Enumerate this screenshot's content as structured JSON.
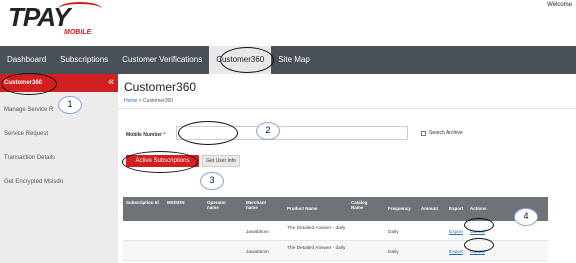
{
  "header": {
    "logo_main": "TPAY",
    "logo_sub": "MOBILE",
    "welcome": "Welcome"
  },
  "nav": {
    "items": [
      {
        "label": "Dashboard"
      },
      {
        "label": "Subscriptions"
      },
      {
        "label": "Customer Verifications"
      },
      {
        "label": "Customer360"
      },
      {
        "label": "Site Map"
      }
    ]
  },
  "sidebar": {
    "toggle_glyph": "«",
    "items": [
      {
        "label": "Customer360"
      },
      {
        "label": "Manage Service R"
      },
      {
        "label": "Service Request"
      },
      {
        "label": "Transaction Details"
      },
      {
        "label": "Get Encrypted Msisdn"
      }
    ]
  },
  "main": {
    "title": "Customer360",
    "breadcrumb": {
      "home": "Home",
      "separator": " > ",
      "current": "Customer360"
    },
    "form": {
      "mobile_label": "Mobile Number",
      "required_mark": "*",
      "mobile_value": "",
      "archive_label": "Search Archive"
    },
    "buttons": {
      "active_subscriptions": "Active Subscriptions",
      "get_user_info": "Get User Info"
    },
    "table": {
      "headers": [
        "Subscription Id",
        "MSISDN",
        "Operator name",
        "Merchant name",
        "Product Name",
        "Catalog Name",
        "Frequency",
        "Amount",
        "Export",
        "Actions"
      ],
      "rows": [
        {
          "merchant": "Jawabkom",
          "product": "The Detailed Answer - daily",
          "frequency": "Daily",
          "export": "Export",
          "action": "Cancel"
        },
        {
          "merchant": "Jawabkom",
          "product": "The Detailed Answer - daily",
          "frequency": "Daily",
          "export": "Export",
          "action": "Cancel"
        }
      ]
    }
  },
  "annotations": [
    "1",
    "2",
    "3",
    "4"
  ],
  "colors": {
    "brand_red": "#d21f1f",
    "nav_bg": "#4a5057",
    "table_header": "#6e7379",
    "link": "#2a6ebb"
  }
}
